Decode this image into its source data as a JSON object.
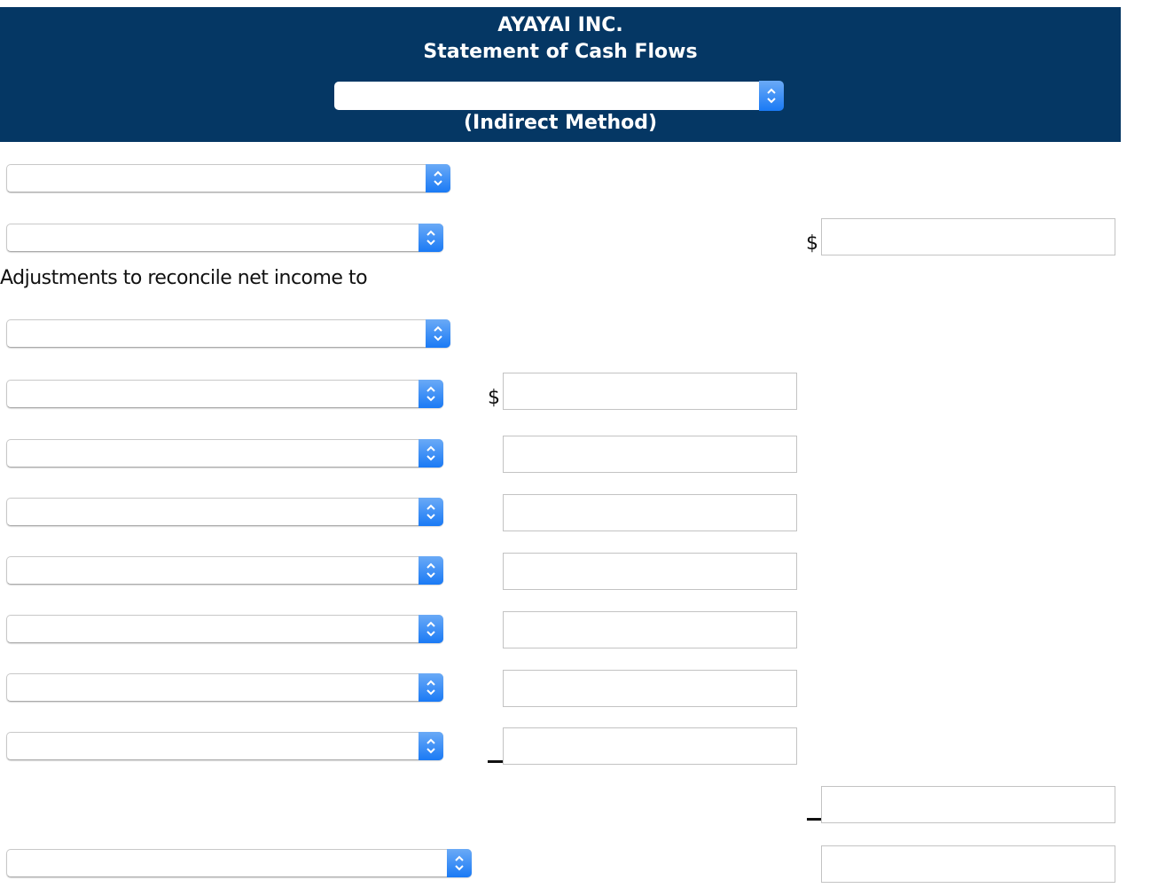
{
  "header": {
    "company": "AYAYAI INC.",
    "title": "Statement of Cash Flows",
    "period_select": {
      "value": ""
    },
    "method": "(Indirect Method)"
  },
  "colors": {
    "header_bg": "#053764",
    "select_arrow": "#1a7af5"
  },
  "icons": {
    "select_arrow": "up-down-chevron-icon"
  },
  "rows": {
    "section_select": {
      "value": ""
    },
    "net_income_select": {
      "value": "",
      "currency": "$",
      "amount": ""
    },
    "adjustments_label": "Adjustments to reconcile net income to",
    "adjustment_header_select": {
      "value": ""
    },
    "adjustments": [
      {
        "select": "",
        "currency": "$",
        "amount": ""
      },
      {
        "select": "",
        "currency": "",
        "amount": ""
      },
      {
        "select": "",
        "currency": "",
        "amount": ""
      },
      {
        "select": "",
        "currency": "",
        "amount": ""
      },
      {
        "select": "",
        "currency": "",
        "amount": ""
      },
      {
        "select": "",
        "currency": "",
        "amount": ""
      },
      {
        "select": "",
        "currency": "",
        "amount": ""
      }
    ],
    "total_adjustments_amount": "",
    "net_cash_select": {
      "value": "",
      "amount": ""
    }
  }
}
